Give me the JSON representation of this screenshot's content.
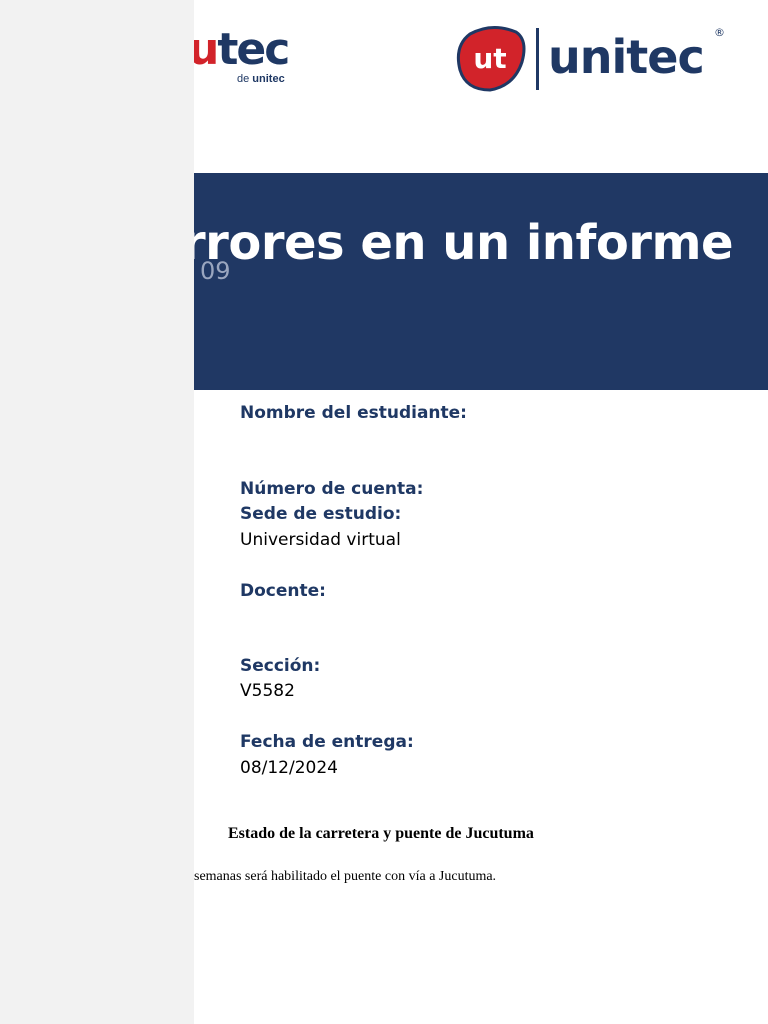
{
  "logos": {
    "small_red": "u",
    "small_blue": "tec",
    "small_sub_prefix": "de ",
    "small_sub_brand": "unitec",
    "big_badge": "ut",
    "big_word": "unitec",
    "big_reg": "®"
  },
  "banner": {
    "title": "rrores en un informe",
    "tag": "09"
  },
  "fields": {
    "student_label": "Nombre del estudiante:",
    "account_label": "Número de cuenta:",
    "campus_label": "Sede de estudio:",
    "campus_value": "Universidad virtual",
    "teacher_label": "Docente:",
    "section_label": "Sección:",
    "section_value": "V5582",
    "date_label": "Fecha de entrega:",
    "date_value": "08/12/2024"
  },
  "document": {
    "heading": "Estado de la carretera y puente de Jucutuma",
    "body": "semanas será habilitado el puente con vía a Jucutuma."
  },
  "colors": {
    "navy": "#203864",
    "brand_red": "#d2232a",
    "panel_gray": "#f2f2f2"
  }
}
